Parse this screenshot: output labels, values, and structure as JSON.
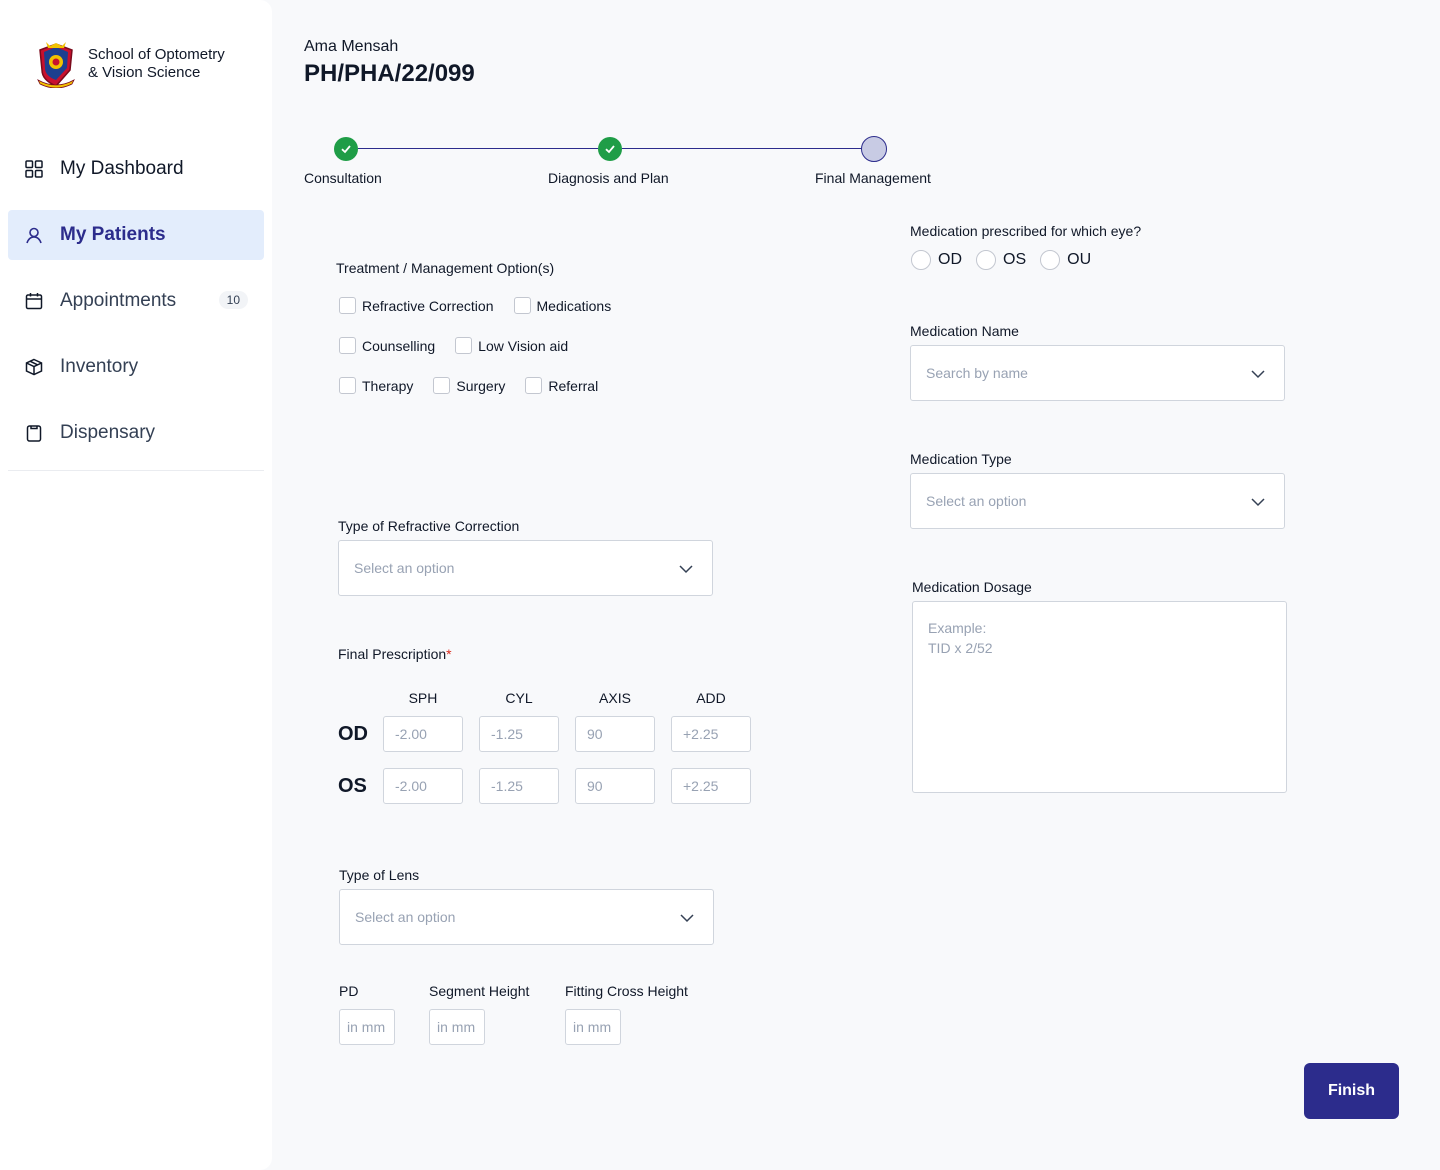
{
  "sidebar": {
    "logo_line1": "School of Optometry",
    "logo_line2": "& Vision Science",
    "items": [
      {
        "label": "My Dashboard",
        "icon": "grid-icon"
      },
      {
        "label": "My Patients",
        "icon": "user-icon",
        "active": true
      },
      {
        "label": "Appointments",
        "icon": "calendar-icon",
        "badge": "10"
      },
      {
        "label": "Inventory",
        "icon": "box-icon"
      },
      {
        "label": "Dispensary",
        "icon": "clipboard-icon"
      }
    ]
  },
  "patient": {
    "name": "Ama Mensah",
    "id": "PH/PHA/22/099"
  },
  "stepper": {
    "steps": [
      {
        "label": "Consultation",
        "status": "done"
      },
      {
        "label": "Diagnosis and Plan",
        "status": "done"
      },
      {
        "label": "Final Management",
        "status": "current"
      }
    ]
  },
  "treatment": {
    "title": "Treatment / Management Option(s)",
    "options": [
      "Refractive Correction",
      "Medications",
      "Counselling",
      "Low Vision aid",
      "Therapy",
      "Surgery",
      "Referral"
    ]
  },
  "refractive": {
    "label": "Type of Refractive Correction",
    "placeholder": "Select an option"
  },
  "prescription": {
    "label": "Final Prescription",
    "required_mark": "*",
    "columns": [
      "SPH",
      "CYL",
      "AXIS",
      "ADD"
    ],
    "rows": [
      {
        "eye": "OD",
        "values": [
          "-2.00",
          "-1.25",
          "90",
          "+2.25"
        ]
      },
      {
        "eye": "OS",
        "values": [
          "-2.00",
          "-1.25",
          "90",
          "+2.25"
        ]
      }
    ]
  },
  "lens": {
    "label": "Type of Lens",
    "placeholder": "Select an option"
  },
  "measurements": {
    "pd_label": "PD",
    "segment_label": "Segment Height",
    "fitting_label": "Fitting Cross Height",
    "placeholder": "in mm"
  },
  "medication": {
    "eye_question": "Medication prescribed for which eye?",
    "eye_options": [
      "OD",
      "OS",
      "OU"
    ],
    "name_label": "Medication Name",
    "name_placeholder": "Search by name",
    "type_label": "Medication Type",
    "type_placeholder": "Select an option",
    "dosage_label": "Medication Dosage",
    "dosage_placeholder": "Example:\nTID x 2/52"
  },
  "actions": {
    "finish_label": "Finish"
  },
  "colors": {
    "primary": "#2c2c8c",
    "success": "#1f9d47",
    "active_bg": "#e3edfc"
  }
}
